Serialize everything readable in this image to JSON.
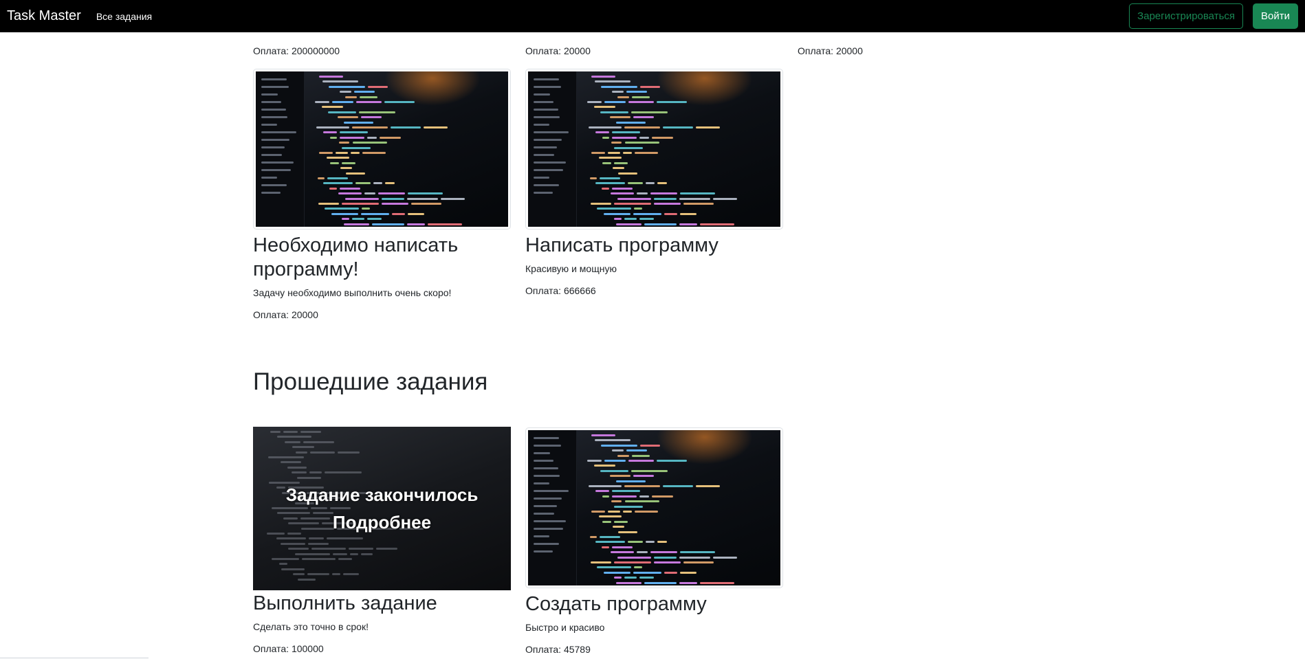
{
  "navbar": {
    "brand": "Task Master",
    "all_tasks": "Все задания",
    "register": "Зарегистрироваться",
    "login": "Войти"
  },
  "top_payments": [
    "Оплата: 200000000",
    "Оплата: 20000",
    "Оплата: 20000"
  ],
  "active_cards": [
    {
      "title": "Необходимо написать программу!",
      "desc": "Задачу необходимо выполнить очень скоро!",
      "pay": "Оплата: 20000"
    },
    {
      "title": "Написать программу",
      "desc": "Красивую и мощную",
      "pay": "Оплата: 666666"
    }
  ],
  "past_section": {
    "title": "Прошедшие задания",
    "overlay_ended": "Задание закончилось",
    "overlay_more": "Подробнее",
    "cards": [
      {
        "title": "Выполнить задание",
        "desc": "Сделать это точно в срок!",
        "pay": "Оплата: 100000"
      },
      {
        "title": "Создать программу",
        "desc": "Быстро и красиво",
        "pay": "Оплата: 45789"
      }
    ]
  },
  "colors": {
    "navbar": "#000000",
    "success": "#198754",
    "text": "#212529"
  }
}
